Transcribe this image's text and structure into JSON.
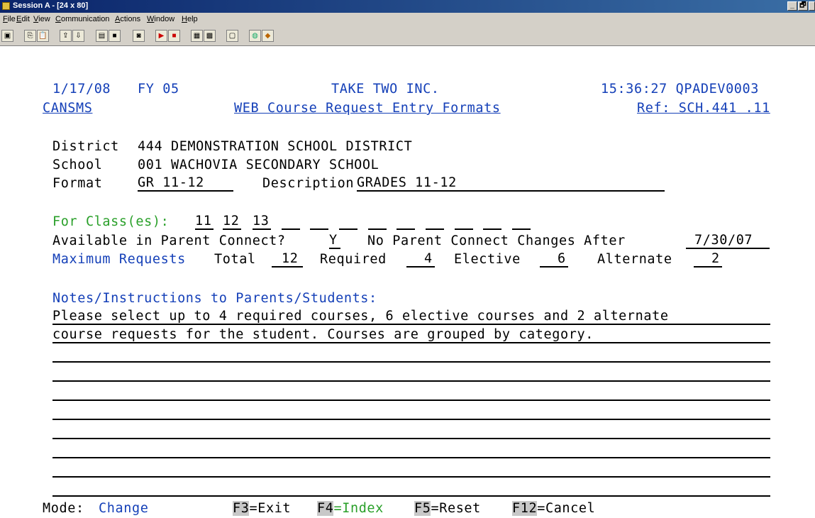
{
  "window": {
    "title": "Session A - [24 x 80]",
    "controls": [
      "_",
      "🗗",
      "X"
    ]
  },
  "menu": [
    "File",
    "Edit",
    "View",
    "Communication",
    "Actions",
    "Window",
    "Help"
  ],
  "toolbar_icons": [
    "display-icon",
    "copy-icon",
    "paste-icon",
    "send-icon",
    "receive-icon",
    "print-screen-icon",
    "print-icon",
    "record-icon",
    "macro-play-icon",
    "macro-stop-icon",
    "customize-keypad-icon",
    "color-map-icon",
    "clipboard-icon",
    "globe-icon",
    "help-icon"
  ],
  "header": {
    "date": "1/17/08",
    "fy": "FY 05",
    "company": "TAKE TWO INC.",
    "time_system": "15:36:27 QPADEV0003",
    "program": "CANSMS",
    "screen_title": "WEB Course Request Entry Formats",
    "ref": "Ref: SCH.441 .11"
  },
  "info": {
    "district_label": "District",
    "district_value": "444 DEMONSTRATION SCHOOL DISTRICT",
    "school_label": "School",
    "school_value": "001 WACHOVIA SECONDARY SCHOOL",
    "format_label": "Format",
    "format_value": "GR 11-12",
    "description_label": "Description",
    "description_value": "GRADES 11-12"
  },
  "classes": {
    "label": "For Class(es):",
    "values": [
      "11",
      "12",
      "13",
      "",
      "",
      "",
      "",
      "",
      "",
      "",
      "",
      "",
      ""
    ]
  },
  "parent_connect": {
    "available_label": "Available in Parent Connect?",
    "available_value": "Y",
    "changes_label": "No Parent Connect Changes After",
    "changes_value": "7/30/07"
  },
  "maximum": {
    "label": "Maximum Requests",
    "total_label": "Total",
    "total_value": "12",
    "required_label": "Required",
    "required_value": "4",
    "elective_label": "Elective",
    "elective_value": "6",
    "alternate_label": "Alternate",
    "alternate_value": "2"
  },
  "notes": {
    "label": "Notes/Instructions to Parents/Students:",
    "lines": [
      "Please select up to 4 required courses, 6 elective courses and 2 alternate",
      "course requests for the student. Courses are grouped by category.",
      "",
      "",
      "",
      "",
      "",
      "",
      "",
      ""
    ]
  },
  "footer": {
    "mode_label": "Mode:",
    "mode_value": "Change",
    "keys": [
      {
        "key": "F3",
        "label": "=Exit"
      },
      {
        "key": "F4",
        "label": "=Index"
      },
      {
        "key": "F5",
        "label": "=Reset"
      },
      {
        "key": "F12",
        "label": "=Cancel"
      }
    ]
  },
  "colors": {
    "title_bar": "#0a246a",
    "field_blue": "#1540b8",
    "prompt_green": "#2aa02a",
    "chrome": "#d4d0c8"
  }
}
